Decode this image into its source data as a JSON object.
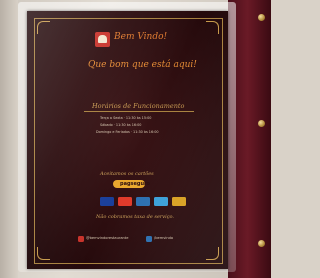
{
  "photo": {
    "subject": "restaurant menu card in a dark red folder",
    "menu": {
      "title": "Bem Vindo!",
      "subtitle": "Que bom que está aqui!",
      "hours_title": "Horários de Funcionamento",
      "hours_lines": [
        "Terça a Sexta  ·  11:30 às 15:00",
        "Sábado  ·  11:30 às 16:00",
        "Domingo e Feriados  ·  11:30 às 16:00"
      ],
      "payment_heading": "Aceitamos os cartões",
      "payment_brand": "pagseguro",
      "cards": [
        {
          "name": "visa",
          "color": "#1a3f9a"
        },
        {
          "name": "mastercard",
          "color": "#e03a2a"
        },
        {
          "name": "elo",
          "color": "#2b6fb0"
        },
        {
          "name": "amex",
          "color": "#3aa0d8"
        },
        {
          "name": "hipercard",
          "color": "#d8a020"
        }
      ],
      "service_note": "Não cobramos taxa de serviço.",
      "social": [
        {
          "icon": "instagram-icon",
          "text": "@bemvindorestaurante"
        },
        {
          "icon": "facebook-icon",
          "text": "/bemvindo"
        }
      ]
    },
    "colors": {
      "menu_background": "#2a0c0e",
      "folder": "#5a1420",
      "accent_orange": "#e07a2e",
      "gold": "#c79a4a"
    }
  }
}
